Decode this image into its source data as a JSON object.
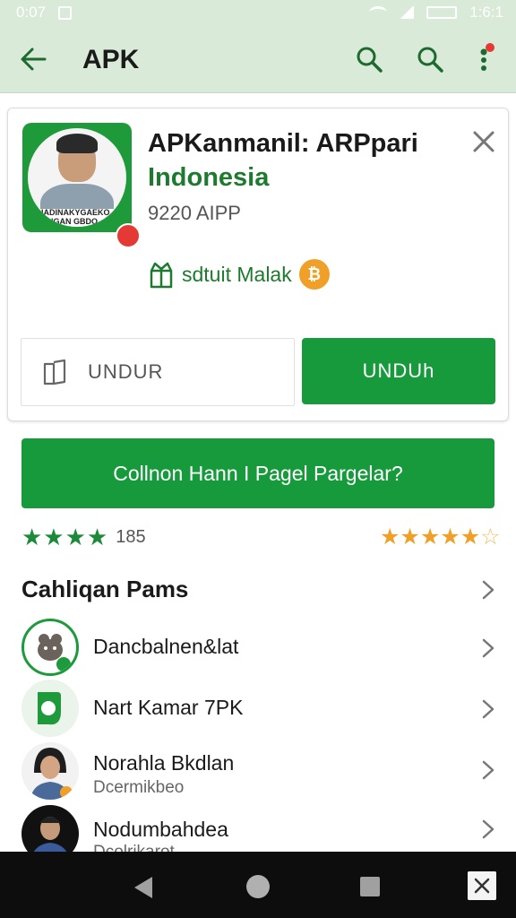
{
  "status_bar": {
    "time": "0:07",
    "right_text": "1:6:1"
  },
  "app_bar": {
    "title": "APK"
  },
  "app_card": {
    "name_line1": "APKanmanil: ARPpari",
    "name_line2": "Indonesia",
    "icon_caption": "DIADINAKYGAEKO HGAN GBDO",
    "size": "9220 AIPP",
    "feature_label": "sdtuit Malak",
    "secondary_button": "UNDUR",
    "primary_button": "UNDUh"
  },
  "cta": {
    "label": "Collnon Hann I Pagel Pargelar?"
  },
  "rating": {
    "stars_left": "★★★★",
    "count": "185",
    "stars_right_value": 4.5
  },
  "section": {
    "title": "Cahliqan Pams"
  },
  "list": [
    {
      "title": "Dancbalnen&lat",
      "subtitle": ""
    },
    {
      "title": "Nart Kamar 7PK",
      "subtitle": ""
    },
    {
      "title": "Norahla Bkdlan",
      "subtitle": "Dcermikbeo"
    },
    {
      "title": "Nodumbahdea",
      "subtitle": "Dcolrikarot"
    }
  ],
  "colors": {
    "primary": "#179a3c",
    "app_bar_bg": "#d9ead9",
    "star": "#f0a028"
  }
}
